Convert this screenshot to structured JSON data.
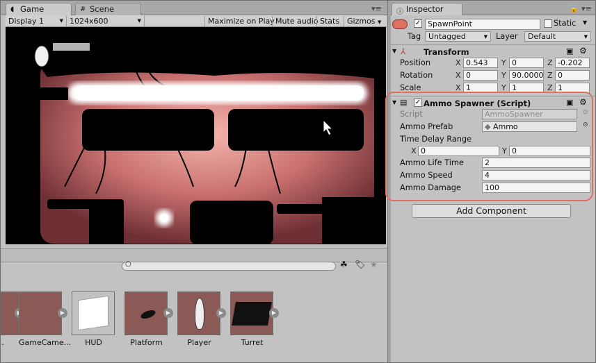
{
  "game_tab": {
    "label": "Game",
    "icon": "pacman-icon"
  },
  "scene_tab": {
    "label": "Scene",
    "icon": "grid-icon"
  },
  "game_toolbar": {
    "display": "Display 1",
    "resolution": "1024x600",
    "maximize": "Maximize on Play",
    "mute": "Mute audio",
    "stats": "Stats",
    "gizmos": "Gizmos"
  },
  "inspector": {
    "tab_label": "Inspector",
    "object_name": "SpawnPoint",
    "static_label": "Static",
    "tag_label": "Tag",
    "tag_value": "Untagged",
    "layer_label": "Layer",
    "layer_value": "Default",
    "transform": {
      "title": "Transform",
      "position_label": "Position",
      "rotation_label": "Rotation",
      "scale_label": "Scale",
      "position": {
        "x": "0.543",
        "y": "0",
        "z": "-0.202"
      },
      "rotation": {
        "x": "0",
        "y": "90.0000",
        "z": "0"
      },
      "scale": {
        "x": "1",
        "y": "1",
        "z": "1"
      }
    },
    "ammo_spawner": {
      "title": "Ammo Spawner (Script)",
      "script_label": "Script",
      "script_value": "AmmoSpawner",
      "prefab_label": "Ammo Prefab",
      "prefab_value": "Ammo",
      "delay_label": "Time Delay Range",
      "delay_x": "0",
      "delay_y": "0",
      "life_label": "Ammo Life Time",
      "life_value": "2",
      "speed_label": "Ammo Speed",
      "speed_value": "4",
      "damage_label": "Ammo Damage",
      "damage_value": "100"
    },
    "add_component": "Add Component",
    "axis": {
      "x": "X",
      "y": "Y",
      "z": "Z"
    }
  },
  "project": {
    "assets": [
      {
        "name": "D...",
        "color": "#8c5a56"
      },
      {
        "name": "GameCame...",
        "color": "#8c5a56"
      },
      {
        "name": "HUD",
        "color": "#c2c2c2"
      },
      {
        "name": "Platform",
        "color": "#8c5a56"
      },
      {
        "name": "Player",
        "color": "#8c5a56"
      },
      {
        "name": "Turret",
        "color": "#8c5a56"
      }
    ]
  },
  "colors": {
    "highlight": "#e07060",
    "thumb_bg": "#8c5a56",
    "game_sky": "#b9606a"
  }
}
